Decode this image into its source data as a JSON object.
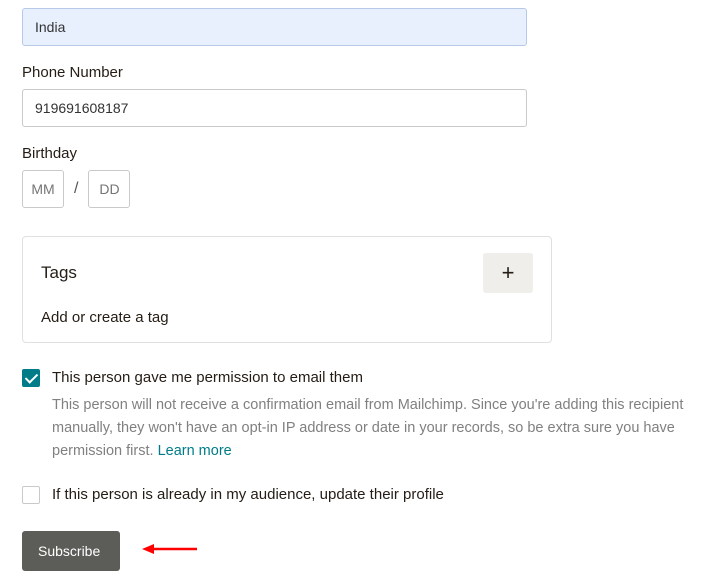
{
  "country": {
    "value": "India"
  },
  "phone": {
    "label": "Phone Number",
    "value": "919691608187"
  },
  "birthday": {
    "label": "Birthday",
    "mm_placeholder": "MM",
    "dd_placeholder": "DD",
    "sep": "/"
  },
  "tags": {
    "title": "Tags",
    "subtitle": "Add or create a tag",
    "plus": "+"
  },
  "consent": {
    "checkbox_label": "This person gave me permission to email them",
    "help_text": "This person will not receive a confirmation email from Mailchimp. Since you're adding this recipient manually, they won't have an opt-in IP address or date in your records, so be extra sure you have permission first. ",
    "learn_more": "Learn more",
    "checked": true
  },
  "update": {
    "label": "If this person is already in my audience, update their profile",
    "checked": false
  },
  "subscribe_label": "Subscribe"
}
